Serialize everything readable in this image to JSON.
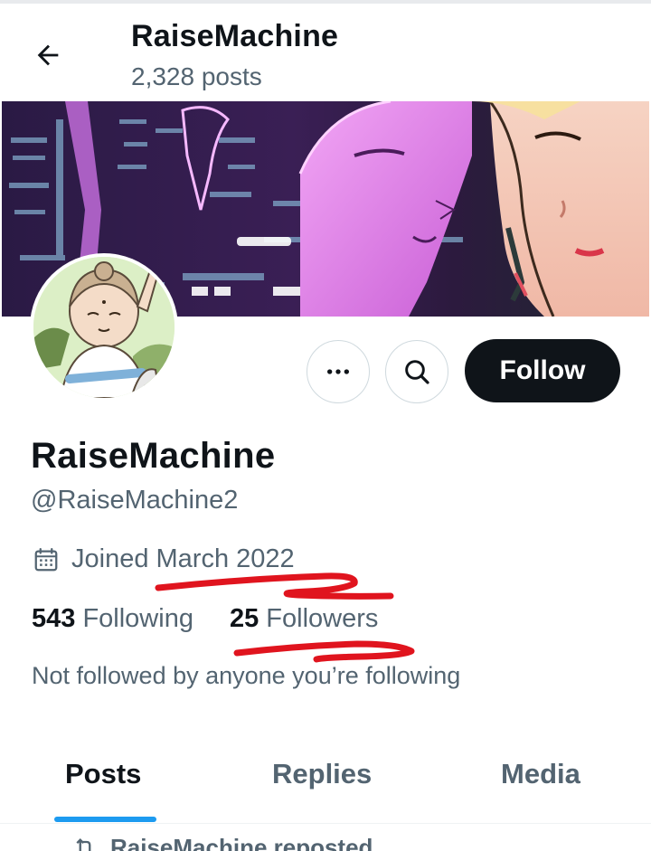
{
  "header": {
    "back_icon": "arrow-left-icon",
    "title": "RaiseMachine",
    "post_count": "2,328 posts"
  },
  "banner": {
    "description_icon": "anime-cityscape-banner"
  },
  "avatar": {
    "icon": "meditating-monk-avatar"
  },
  "actions": {
    "more_icon": "more-horizontal-icon",
    "search_icon": "search-icon",
    "follow_label": "Follow"
  },
  "profile": {
    "name": "RaiseMachine",
    "handle": "@RaiseMachine2",
    "joined_icon": "calendar-icon",
    "joined": "Joined March 2022",
    "following_count": "543",
    "following_label": "Following",
    "followers_count": "25",
    "followers_label": "Followers",
    "mutuals_note": "Not followed by anyone you’re following"
  },
  "tabs": [
    {
      "label": "Posts",
      "active": true
    },
    {
      "label": "Replies",
      "active": false
    },
    {
      "label": "Media",
      "active": false
    }
  ],
  "feed": {
    "first_item_context": "RaiseMachine reposted",
    "repost_icon": "repost-icon"
  },
  "colors": {
    "accent": "#1d9bf0",
    "text_primary": "#0f1419",
    "text_secondary": "#536471",
    "annotation_red": "#e0141e"
  }
}
